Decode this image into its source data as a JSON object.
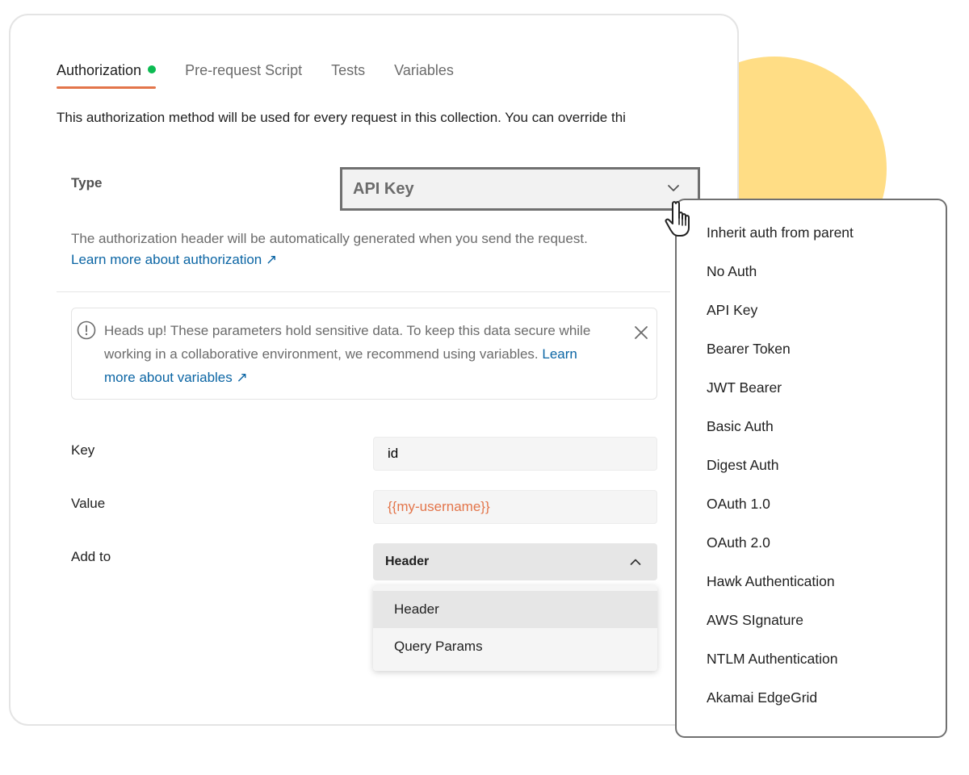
{
  "tabs": [
    {
      "label": "Authorization",
      "active": true
    },
    {
      "label": "Pre-request Script"
    },
    {
      "label": "Tests"
    },
    {
      "label": "Variables"
    }
  ],
  "intro_text": "This authorization method will be used for every request in this collection. You can override thi",
  "type": {
    "label": "Type",
    "selected": "API Key",
    "help_text": "The authorization header will be automatically generated when you send the request.",
    "help_link": "Learn more about authorization ↗"
  },
  "alert": {
    "text": "Heads up! These parameters hold sensitive data. To keep this data secure while working in a collaborative environment, we recommend using variables.",
    "link": "Learn more about variables ↗"
  },
  "fields": {
    "key": {
      "label": "Key",
      "value": "id"
    },
    "value": {
      "label": "Value",
      "value": "{{my-username}}"
    },
    "add_to": {
      "label": "Add to",
      "selected": "Header",
      "options": [
        "Header",
        "Query Params"
      ]
    }
  },
  "type_options": [
    "Inherit auth from parent",
    "No Auth",
    "API Key",
    "Bearer Token",
    "JWT Bearer",
    "Basic Auth",
    "Digest Auth",
    "OAuth 1.0",
    "OAuth 2.0",
    "Hawk Authentication",
    "AWS SIgnature",
    "NTLM Authentication",
    "Akamai EdgeGrid"
  ],
  "colors": {
    "accent": "#e3754a",
    "status_dot": "#0cbb52",
    "link": "#0b65a4",
    "decor": "#ffdd85"
  }
}
